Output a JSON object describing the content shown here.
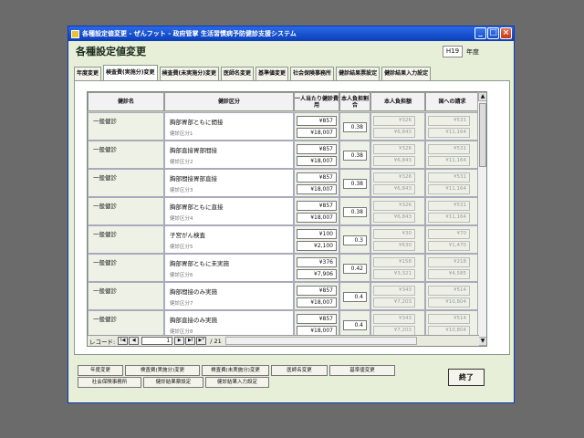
{
  "window": {
    "title": "各種設定値変更 - ぜんフット - 政府管掌 生活習慣病予防健診支援システム",
    "minimize_glyph": "_",
    "maximize_glyph": "□",
    "close_glyph": "×"
  },
  "header": {
    "form_title": "各種設定値変更",
    "year_value": "H19",
    "year_suffix": "年度"
  },
  "tabs": [
    {
      "label": "年度変更"
    },
    {
      "label": "検査費(実施分)変更"
    },
    {
      "label": "検査費(未実施分)変更"
    },
    {
      "label": "医師名変更"
    },
    {
      "label": "基準値変更"
    },
    {
      "label": "社会保険事務所"
    },
    {
      "label": "健診結果票設定"
    },
    {
      "label": "健診結果入力設定"
    }
  ],
  "columns": {
    "kind": "健診名",
    "category": "健診区分",
    "cost_per_person": "一人当たり健診費用",
    "rate": "本人負担割合",
    "self_pay": "本人負担額",
    "claim": "国への請求"
  },
  "rows": [
    {
      "kind": "一般健診",
      "category": "胸部胃部ともに間接",
      "code": "健診区分1",
      "cost1": "¥857",
      "cost2": "¥18,007",
      "rate": "0.38",
      "self1": "¥326",
      "self2": "¥6,843",
      "claim1": "¥531",
      "claim2": "¥11,164"
    },
    {
      "kind": "一般健診",
      "category": "胸部直接胃部間接",
      "code": "健診区分2",
      "cost1": "¥857",
      "cost2": "¥18,007",
      "rate": "0.38",
      "self1": "¥326",
      "self2": "¥6,843",
      "claim1": "¥531",
      "claim2": "¥11,164"
    },
    {
      "kind": "一般健診",
      "category": "胸部間接胃部直接",
      "code": "健診区分3",
      "cost1": "¥857",
      "cost2": "¥18,007",
      "rate": "0.38",
      "self1": "¥326",
      "self2": "¥6,843",
      "claim1": "¥531",
      "claim2": "¥11,164"
    },
    {
      "kind": "一般健診",
      "category": "胸部胃部ともに直接",
      "code": "健診区分4",
      "cost1": "¥857",
      "cost2": "¥18,007",
      "rate": "0.38",
      "self1": "¥326",
      "self2": "¥6,843",
      "claim1": "¥531",
      "claim2": "¥11,164"
    },
    {
      "kind": "一般健診",
      "category": "子宮がん検査",
      "code": "健診区分5",
      "cost1": "¥100",
      "cost2": "¥2,100",
      "rate": "0.3",
      "self1": "¥30",
      "self2": "¥630",
      "claim1": "¥70",
      "claim2": "¥1,470"
    },
    {
      "kind": "一般健診",
      "category": "胸部胃部ともに未実施",
      "code": "健診区分6",
      "cost1": "¥376",
      "cost2": "¥7,906",
      "rate": "0.42",
      "self1": "¥158",
      "self2": "¥3,321",
      "claim1": "¥218",
      "claim2": "¥4,585"
    },
    {
      "kind": "一般健診",
      "category": "胸部間接のみ実施",
      "code": "健診区分7",
      "cost1": "¥857",
      "cost2": "¥18,007",
      "rate": "0.4",
      "self1": "¥343",
      "self2": "¥7,203",
      "claim1": "¥514",
      "claim2": "¥10,804"
    },
    {
      "kind": "一般健診",
      "category": "胸部直接のみ実施",
      "code": "健診区分8",
      "cost1": "¥857",
      "cost2": "¥18,007",
      "rate": "0.4",
      "self1": "¥343",
      "self2": "¥7,203",
      "claim1": "¥514",
      "claim2": "¥10,804"
    }
  ],
  "nav": {
    "label": "レコード:",
    "first": "I◀",
    "prev": "◀",
    "current": "1",
    "next": "▶",
    "last": "▶I",
    "new": "▶*",
    "total": "/ 21"
  },
  "footer_buttons": {
    "year": "年度変更",
    "exam_done": "検査費(実施分)変更",
    "exam_not_done": "検査費(未実施分)変更",
    "doctor": "医師名変更",
    "standard": "基準値変更",
    "insurance_office": "社会保険事務所",
    "result_sheet": "健診結果票設定",
    "result_input": "健診結果入力設定",
    "exit": "終了"
  }
}
